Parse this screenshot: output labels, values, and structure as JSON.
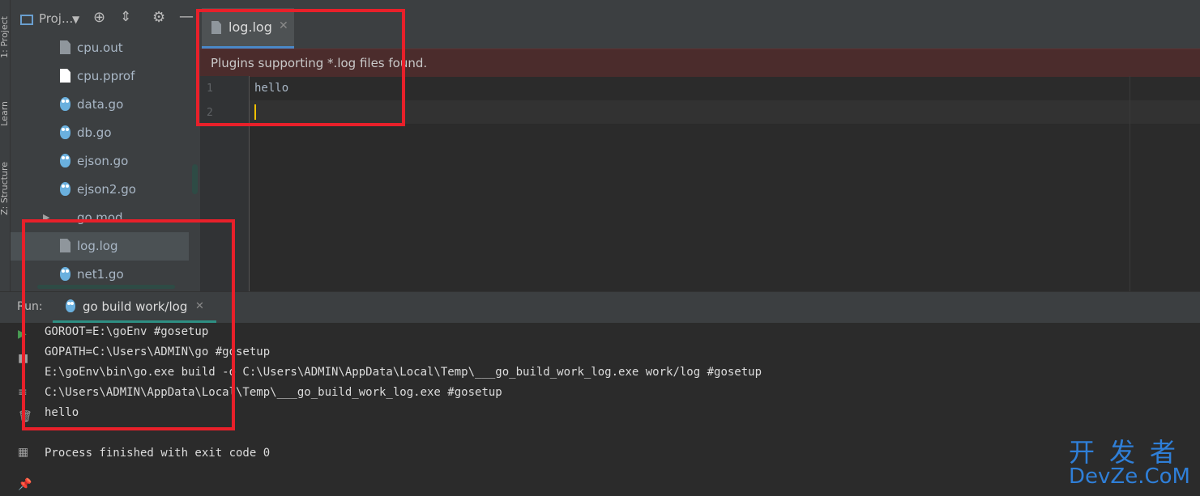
{
  "sidebar_tabs": [
    "1: Project",
    "Learn",
    "Z: Structure"
  ],
  "project_panel": {
    "title": "Proj...",
    "files": [
      {
        "name": "cpu.out",
        "icon": "doc"
      },
      {
        "name": "cpu.pprof",
        "icon": "doc-white"
      },
      {
        "name": "data.go",
        "icon": "gopher"
      },
      {
        "name": "db.go",
        "icon": "gopher"
      },
      {
        "name": "ejson.go",
        "icon": "gopher"
      },
      {
        "name": "ejson2.go",
        "icon": "gopher"
      },
      {
        "name": "go.mod",
        "icon": "folder-arrow"
      },
      {
        "name": "log.log",
        "icon": "doc",
        "selected": true
      },
      {
        "name": "net1.go",
        "icon": "gopher"
      }
    ]
  },
  "editor": {
    "tab_label": "log.log",
    "banner": "Plugins supporting *.log files found.",
    "lines": [
      {
        "number": "1",
        "text": "hello"
      },
      {
        "number": "2",
        "text": ""
      }
    ]
  },
  "run": {
    "label": "Run:",
    "tab_label": "go build work/log",
    "output": [
      "GOROOT=E:\\goEnv #gosetup",
      "GOPATH=C:\\Users\\ADMIN\\go #gosetup",
      "E:\\goEnv\\bin\\go.exe build -o C:\\Users\\ADMIN\\AppData\\Local\\Temp\\___go_build_work_log.exe work/log #gosetup",
      "C:\\Users\\ADMIN\\AppData\\Local\\Temp\\___go_build_work_log.exe #gosetup",
      "hello",
      "",
      "Process finished with exit code 0"
    ]
  },
  "watermark": {
    "cn": "开发者",
    "en": "DevZe.CoM"
  },
  "colors": {
    "accent": "#4a88c7",
    "highlight": "#e8202a",
    "banner_bg": "#4b2c2c",
    "caret": "#f0c000"
  }
}
